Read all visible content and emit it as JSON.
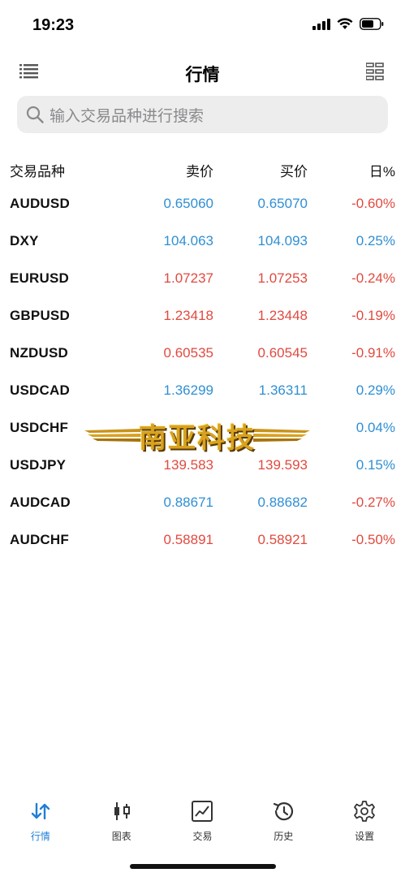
{
  "status": {
    "time": "19:23",
    "icons": [
      "signal-icon",
      "wifi-icon",
      "battery-icon"
    ]
  },
  "nav": {
    "title": "行情",
    "left_icon": "list-icon",
    "right_icon": "grid-list-icon"
  },
  "search": {
    "placeholder": "输入交易品种进行搜索",
    "icon": "search-icon"
  },
  "table": {
    "headers": {
      "symbol": "交易品种",
      "bid": "卖价",
      "ask": "买价",
      "change": "日%"
    },
    "rows": [
      {
        "symbol": "AUDUSD",
        "bid": "0.65060",
        "ask": "0.65070",
        "change": "-0.60%",
        "price_color": "up",
        "change_color": "down"
      },
      {
        "symbol": "DXY",
        "bid": "104.063",
        "ask": "104.093",
        "change": "0.25%",
        "price_color": "up",
        "change_color": "up"
      },
      {
        "symbol": "EURUSD",
        "bid": "1.07237",
        "ask": "1.07253",
        "change": "-0.24%",
        "price_color": "down",
        "change_color": "down"
      },
      {
        "symbol": "GBPUSD",
        "bid": "1.23418",
        "ask": "1.23448",
        "change": "-0.19%",
        "price_color": "down",
        "change_color": "down"
      },
      {
        "symbol": "NZDUSD",
        "bid": "0.60535",
        "ask": "0.60545",
        "change": "-0.91%",
        "price_color": "down",
        "change_color": "down"
      },
      {
        "symbol": "USDCAD",
        "bid": "1.36299",
        "ask": "1.36311",
        "change": "0.29%",
        "price_color": "up",
        "change_color": "up"
      },
      {
        "symbol": "USDCHF",
        "bid": "",
        "ask": "",
        "change": "0.04%",
        "price_color": "up",
        "change_color": "up"
      },
      {
        "symbol": "USDJPY",
        "bid": "139.583",
        "ask": "139.593",
        "change": "0.15%",
        "price_color": "down",
        "change_color": "up"
      },
      {
        "symbol": "AUDCAD",
        "bid": "0.88671",
        "ask": "0.88682",
        "change": "-0.27%",
        "price_color": "up",
        "change_color": "down"
      },
      {
        "symbol": "AUDCHF",
        "bid": "0.58891",
        "ask": "0.58921",
        "change": "-0.50%",
        "price_color": "down",
        "change_color": "down"
      }
    ]
  },
  "watermark": {
    "text": "南亚科技"
  },
  "colors": {
    "up": "#2f8fd4",
    "down": "#e04a3f",
    "active_tab": "#1f7ed6"
  },
  "tabs": [
    {
      "label": "行情",
      "icon": "quotes-arrows-icon",
      "active": true
    },
    {
      "label": "图表",
      "icon": "candlestick-icon",
      "active": false
    },
    {
      "label": "交易",
      "icon": "trade-chart-icon",
      "active": false
    },
    {
      "label": "历史",
      "icon": "history-clock-icon",
      "active": false
    },
    {
      "label": "设置",
      "icon": "settings-gear-icon",
      "active": false
    }
  ]
}
